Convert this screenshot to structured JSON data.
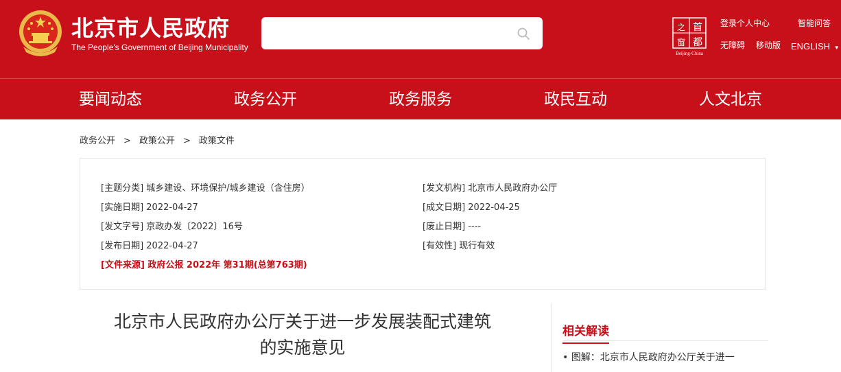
{
  "header": {
    "title": "北京市人民政府",
    "subtitle": "The People's Government of Beijing Municipality",
    "search": {
      "placeholder": ""
    },
    "capital_logo": {
      "top": "首都",
      "bottom_left": "之窗",
      "caption": "Beijing-China"
    },
    "links": {
      "login": "登录个人中心",
      "smart_qa": "智能问答",
      "accessibility": "无障碍",
      "mobile": "移动版",
      "language": "ENGLISH",
      "language_arrow": "▼"
    },
    "brand_color": "#c8101b"
  },
  "nav": {
    "items": [
      "要闻动态",
      "政务公开",
      "政务服务",
      "政民互动",
      "人文北京"
    ]
  },
  "breadcrumb": {
    "items": [
      "政务公开",
      "政策公开",
      "政策文件"
    ],
    "separator": ">"
  },
  "info": {
    "left": [
      "[主题分类] 城乡建设、环境保护/城乡建设（含住房）",
      "[实施日期] 2022-04-27",
      "[发文字号] 京政办发〔2022〕16号",
      "[发布日期] 2022-04-27"
    ],
    "right": [
      "[发文机构] 北京市人民政府办公厅",
      "[成文日期] 2022-04-25",
      "[废止日期] ----",
      "[有效性] 现行有效"
    ],
    "source": "[文件来源] 政府公报 2022年 第31期(总第763期)"
  },
  "document": {
    "title_line1": "北京市人民政府办公厅关于进一步发展装配式建筑",
    "title_line2": "的实施意见"
  },
  "related": {
    "heading": "相关解读",
    "items": [
      "• 图解：北京市人民政府办公厅关于进一"
    ]
  }
}
